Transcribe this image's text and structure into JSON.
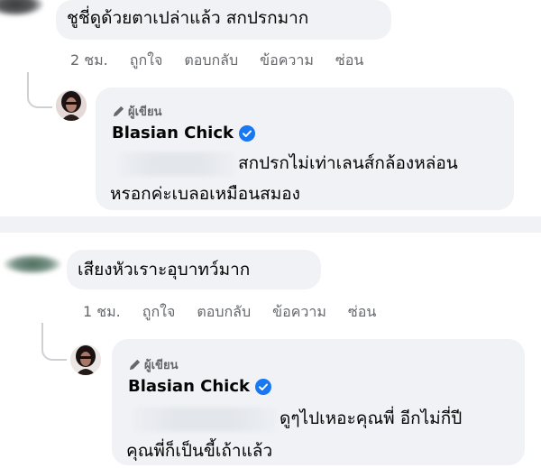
{
  "comment1": {
    "text": "ชูชี่ดูด้วยตาเปล่าแล้ว สกปรกมาก",
    "time": "2 ชม.",
    "like_label": "ถูกใจ",
    "reply_label": "ตอบกลับ",
    "message_label": "ข้อความ",
    "hide_label": "ซ่อน",
    "reply": {
      "author_badge": "ผู้เขียน",
      "name": "Blasian Chick",
      "line1": "สกปรกไม่เท่าเลนส์กล้องหล่อน",
      "line2": "หรอกค่ะเบลอเหมือนสมอง"
    }
  },
  "comment2": {
    "text": "เสียงหัวเราะอุบาทว์มาก",
    "time": "1 ชม.",
    "like_label": "ถูกใจ",
    "reply_label": "ตอบกลับ",
    "message_label": "ข้อความ",
    "hide_label": "ซ่อน",
    "reply": {
      "author_badge": "ผู้เขียน",
      "name": "Blasian Chick",
      "line1": "ดูๆไปเหอะคุณพี่ อีกไม่กี่ปี",
      "line2": "คุณพี่ก็เป็นขี้เถ้าแล้ว"
    }
  },
  "colors": {
    "bubble": "#f0f2f5",
    "secondary_text": "#65676b",
    "verified_blue": "#1877f2",
    "separator": "#f0f2f5"
  },
  "icons": [
    "pencil-icon",
    "verified-badge-icon"
  ]
}
